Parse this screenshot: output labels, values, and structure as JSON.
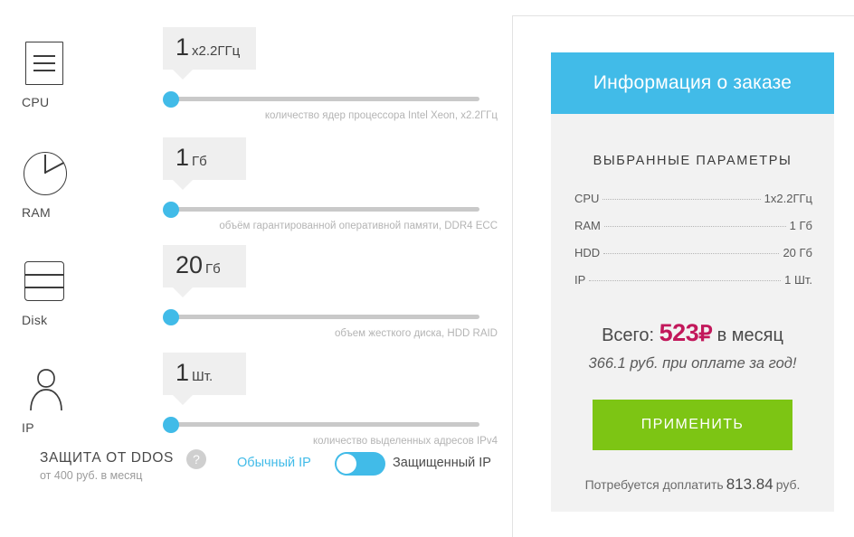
{
  "configurator": {
    "rows": [
      {
        "key": "cpu",
        "icon": "cpu-icon",
        "label": "CPU",
        "value": "1",
        "unit": "x2.2ГГц",
        "hint": "количество ядер процессора Intel Xeon, x2.2ГГц",
        "thumb_percent": 0
      },
      {
        "key": "ram",
        "icon": "ram-pie-icon",
        "label": "RAM",
        "value": "1",
        "unit": "Гб",
        "hint": "объём гарантированной оперативной памяти, DDR4 ECC",
        "thumb_percent": 0
      },
      {
        "key": "disk",
        "icon": "disk-icon",
        "label": "Disk",
        "value": "20",
        "unit": "Гб",
        "hint": "объем жесткого диска, HDD RAID",
        "thumb_percent": 0
      },
      {
        "key": "ip",
        "icon": "person-icon",
        "label": "IP",
        "value": "1",
        "unit": "Шт.",
        "hint": "количество выделенных адресов IPv4",
        "thumb_percent": 0
      }
    ],
    "ddos": {
      "title": "ЗАЩИТА ОТ DDOS",
      "subtitle": "от 400 руб. в месяц",
      "help_glyph": "?",
      "mode_left": "Обычный IP",
      "mode_right": "Защищенный IP",
      "toggle_state": "left"
    }
  },
  "order": {
    "header_title": "Информация о заказе",
    "params_title": "ВЫБРАННЫЕ ПАРАМЕТРЫ",
    "params": [
      {
        "name": "CPU",
        "value": "1x2.2ГГц"
      },
      {
        "name": "RAM",
        "value": "1 Гб"
      },
      {
        "name": "HDD",
        "value": "20 Гб"
      },
      {
        "name": "IP",
        "value": "1 Шт."
      }
    ],
    "total_prefix": "Всего:",
    "total_price": "523",
    "currency_glyph": "₽",
    "total_suffix": "в месяц",
    "yearly_note": "366.1 руб. при оплате за год!",
    "apply_label": "ПРИМЕНИТЬ",
    "surcharge_prefix": "Потребуется доплатить",
    "surcharge_amount": "813.84",
    "surcharge_suffix": "руб."
  },
  "colors": {
    "accent_blue": "#41bbe8",
    "apply_green": "#7dc514",
    "price_crimson": "#c2185b",
    "panel_gray": "#f2f2f2",
    "bubble_gray": "#efefef",
    "track_gray": "#c9c9c9"
  }
}
